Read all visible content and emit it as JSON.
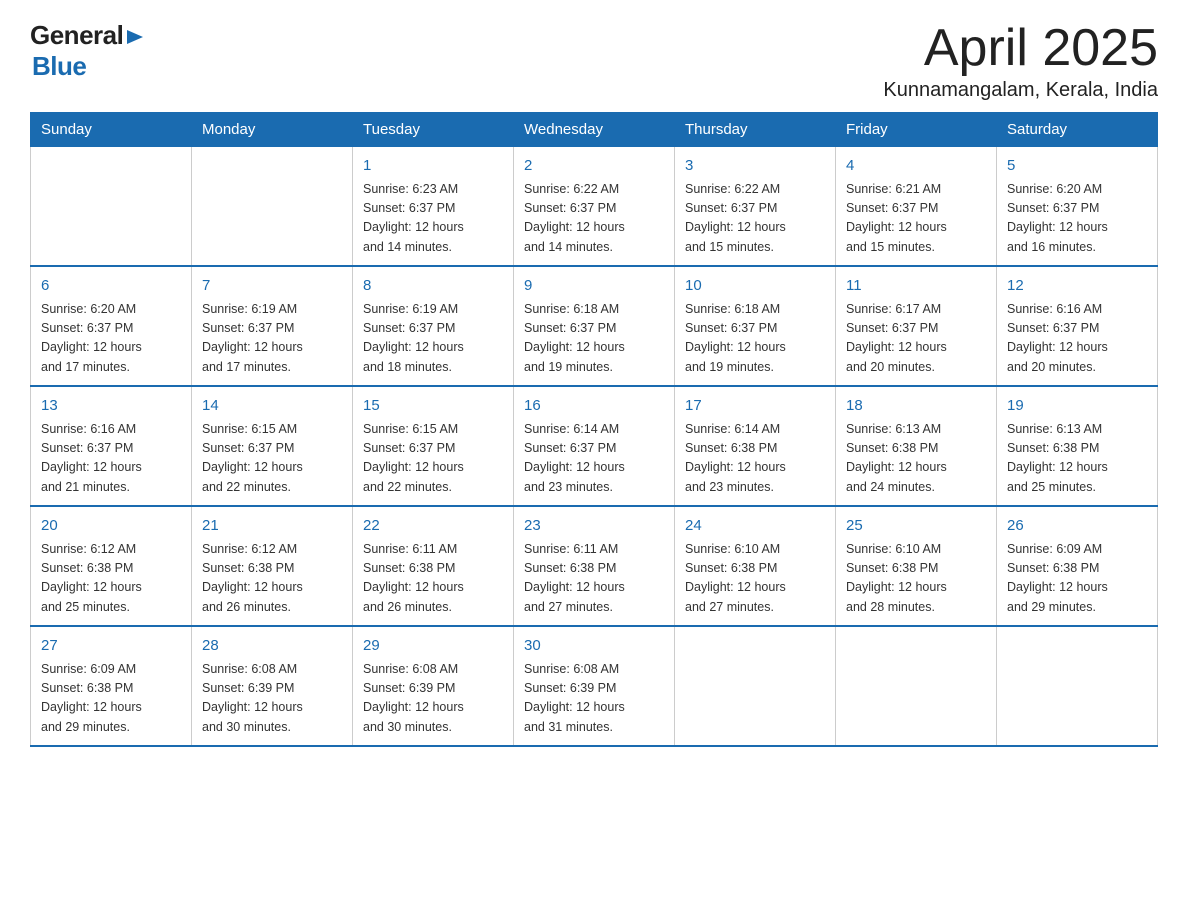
{
  "header": {
    "logo_general": "General",
    "logo_blue": "Blue",
    "month_title": "April 2025",
    "location": "Kunnamangalam, Kerala, India"
  },
  "weekdays": [
    "Sunday",
    "Monday",
    "Tuesday",
    "Wednesday",
    "Thursday",
    "Friday",
    "Saturday"
  ],
  "weeks": [
    [
      {
        "day": "",
        "info": ""
      },
      {
        "day": "",
        "info": ""
      },
      {
        "day": "1",
        "info": "Sunrise: 6:23 AM\nSunset: 6:37 PM\nDaylight: 12 hours\nand 14 minutes."
      },
      {
        "day": "2",
        "info": "Sunrise: 6:22 AM\nSunset: 6:37 PM\nDaylight: 12 hours\nand 14 minutes."
      },
      {
        "day": "3",
        "info": "Sunrise: 6:22 AM\nSunset: 6:37 PM\nDaylight: 12 hours\nand 15 minutes."
      },
      {
        "day": "4",
        "info": "Sunrise: 6:21 AM\nSunset: 6:37 PM\nDaylight: 12 hours\nand 15 minutes."
      },
      {
        "day": "5",
        "info": "Sunrise: 6:20 AM\nSunset: 6:37 PM\nDaylight: 12 hours\nand 16 minutes."
      }
    ],
    [
      {
        "day": "6",
        "info": "Sunrise: 6:20 AM\nSunset: 6:37 PM\nDaylight: 12 hours\nand 17 minutes."
      },
      {
        "day": "7",
        "info": "Sunrise: 6:19 AM\nSunset: 6:37 PM\nDaylight: 12 hours\nand 17 minutes."
      },
      {
        "day": "8",
        "info": "Sunrise: 6:19 AM\nSunset: 6:37 PM\nDaylight: 12 hours\nand 18 minutes."
      },
      {
        "day": "9",
        "info": "Sunrise: 6:18 AM\nSunset: 6:37 PM\nDaylight: 12 hours\nand 19 minutes."
      },
      {
        "day": "10",
        "info": "Sunrise: 6:18 AM\nSunset: 6:37 PM\nDaylight: 12 hours\nand 19 minutes."
      },
      {
        "day": "11",
        "info": "Sunrise: 6:17 AM\nSunset: 6:37 PM\nDaylight: 12 hours\nand 20 minutes."
      },
      {
        "day": "12",
        "info": "Sunrise: 6:16 AM\nSunset: 6:37 PM\nDaylight: 12 hours\nand 20 minutes."
      }
    ],
    [
      {
        "day": "13",
        "info": "Sunrise: 6:16 AM\nSunset: 6:37 PM\nDaylight: 12 hours\nand 21 minutes."
      },
      {
        "day": "14",
        "info": "Sunrise: 6:15 AM\nSunset: 6:37 PM\nDaylight: 12 hours\nand 22 minutes."
      },
      {
        "day": "15",
        "info": "Sunrise: 6:15 AM\nSunset: 6:37 PM\nDaylight: 12 hours\nand 22 minutes."
      },
      {
        "day": "16",
        "info": "Sunrise: 6:14 AM\nSunset: 6:37 PM\nDaylight: 12 hours\nand 23 minutes."
      },
      {
        "day": "17",
        "info": "Sunrise: 6:14 AM\nSunset: 6:38 PM\nDaylight: 12 hours\nand 23 minutes."
      },
      {
        "day": "18",
        "info": "Sunrise: 6:13 AM\nSunset: 6:38 PM\nDaylight: 12 hours\nand 24 minutes."
      },
      {
        "day": "19",
        "info": "Sunrise: 6:13 AM\nSunset: 6:38 PM\nDaylight: 12 hours\nand 25 minutes."
      }
    ],
    [
      {
        "day": "20",
        "info": "Sunrise: 6:12 AM\nSunset: 6:38 PM\nDaylight: 12 hours\nand 25 minutes."
      },
      {
        "day": "21",
        "info": "Sunrise: 6:12 AM\nSunset: 6:38 PM\nDaylight: 12 hours\nand 26 minutes."
      },
      {
        "day": "22",
        "info": "Sunrise: 6:11 AM\nSunset: 6:38 PM\nDaylight: 12 hours\nand 26 minutes."
      },
      {
        "day": "23",
        "info": "Sunrise: 6:11 AM\nSunset: 6:38 PM\nDaylight: 12 hours\nand 27 minutes."
      },
      {
        "day": "24",
        "info": "Sunrise: 6:10 AM\nSunset: 6:38 PM\nDaylight: 12 hours\nand 27 minutes."
      },
      {
        "day": "25",
        "info": "Sunrise: 6:10 AM\nSunset: 6:38 PM\nDaylight: 12 hours\nand 28 minutes."
      },
      {
        "day": "26",
        "info": "Sunrise: 6:09 AM\nSunset: 6:38 PM\nDaylight: 12 hours\nand 29 minutes."
      }
    ],
    [
      {
        "day": "27",
        "info": "Sunrise: 6:09 AM\nSunset: 6:38 PM\nDaylight: 12 hours\nand 29 minutes."
      },
      {
        "day": "28",
        "info": "Sunrise: 6:08 AM\nSunset: 6:39 PM\nDaylight: 12 hours\nand 30 minutes."
      },
      {
        "day": "29",
        "info": "Sunrise: 6:08 AM\nSunset: 6:39 PM\nDaylight: 12 hours\nand 30 minutes."
      },
      {
        "day": "30",
        "info": "Sunrise: 6:08 AM\nSunset: 6:39 PM\nDaylight: 12 hours\nand 31 minutes."
      },
      {
        "day": "",
        "info": ""
      },
      {
        "day": "",
        "info": ""
      },
      {
        "day": "",
        "info": ""
      }
    ]
  ]
}
